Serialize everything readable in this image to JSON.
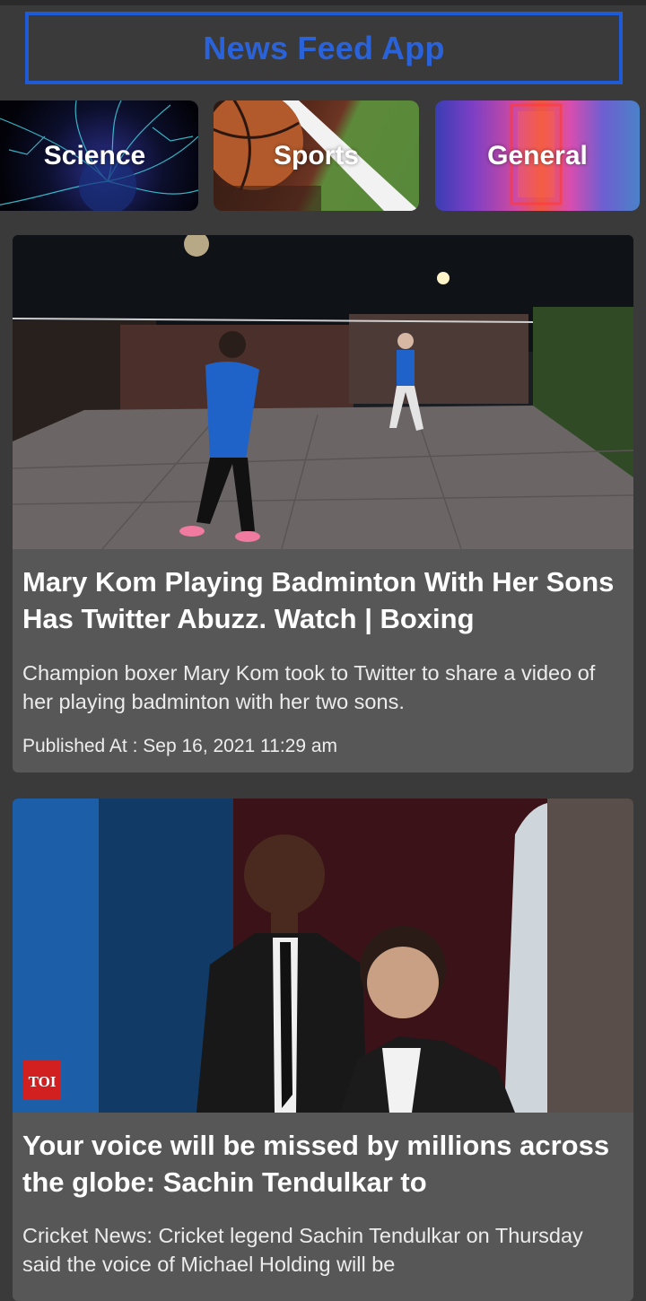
{
  "app": {
    "title": "News Feed App"
  },
  "categories": [
    {
      "label": "Science"
    },
    {
      "label": "Sports"
    },
    {
      "label": "General"
    }
  ],
  "articles": [
    {
      "title": "Mary Kom Playing Badminton With Her Sons Has Twitter Abuzz. Watch | Boxing",
      "description": "Champion boxer Mary Kom took to Twitter to share a video of her playing badminton with her two sons.",
      "published": "Published At : Sep 16, 2021 11:29 am"
    },
    {
      "title": "Your voice will be missed by millions across the globe: Sachin Tendulkar to",
      "description": "Cricket News: Cricket legend Sachin Tendulkar on Thursday said the voice of Michael Holding will be",
      "badge": "TOI"
    }
  ]
}
